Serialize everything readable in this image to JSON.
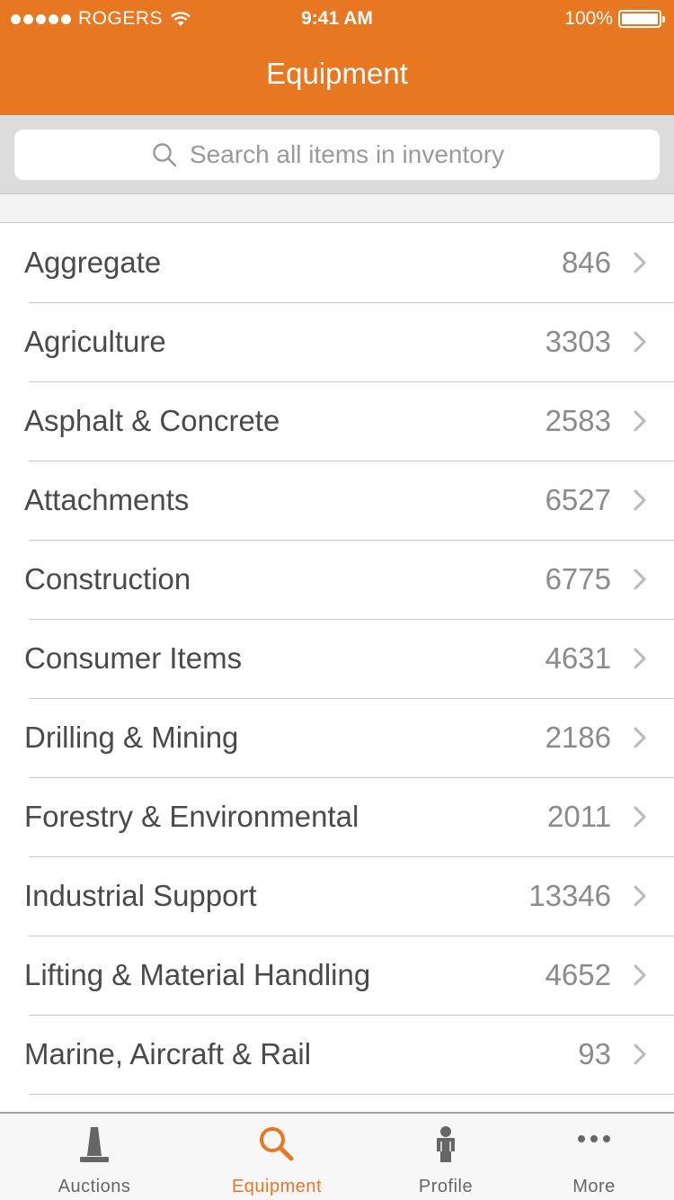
{
  "status_bar": {
    "carrier": "ROGERS",
    "time": "9:41 AM",
    "battery": "100%",
    "battery_level": 1.0
  },
  "nav": {
    "title": "Equipment"
  },
  "search": {
    "placeholder": "Search all items in inventory",
    "value": ""
  },
  "categories": [
    {
      "label": "Aggregate",
      "count": "846"
    },
    {
      "label": "Agriculture",
      "count": "3303"
    },
    {
      "label": "Asphalt & Concrete",
      "count": "2583"
    },
    {
      "label": "Attachments",
      "count": "6527"
    },
    {
      "label": "Construction",
      "count": "6775"
    },
    {
      "label": "Consumer Items",
      "count": "4631"
    },
    {
      "label": "Drilling & Mining",
      "count": "2186"
    },
    {
      "label": "Forestry & Environmental",
      "count": "2011"
    },
    {
      "label": "Industrial Support",
      "count": "13346"
    },
    {
      "label": "Lifting & Material Handling",
      "count": "4652"
    },
    {
      "label": "Marine, Aircraft & Rail",
      "count": "93"
    }
  ],
  "tabs": [
    {
      "label": "Auctions",
      "icon": "auction-cone-icon",
      "active": false
    },
    {
      "label": "Equipment",
      "icon": "search-icon",
      "active": true
    },
    {
      "label": "Profile",
      "icon": "person-icon",
      "active": false
    },
    {
      "label": "More",
      "icon": "more-dots-icon",
      "active": false
    }
  ],
  "colors": {
    "accent": "#e87722",
    "inactive_tab": "#666666",
    "row_text": "#4a4a4a",
    "count_text": "#8b8b8b"
  }
}
